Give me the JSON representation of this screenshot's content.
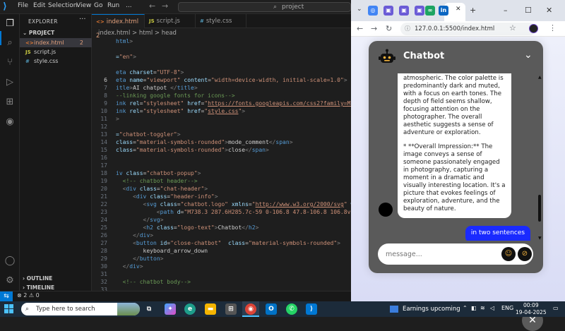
{
  "vscode": {
    "menu": [
      "File",
      "Edit",
      "Selection",
      "View",
      "Go",
      "Run",
      "..."
    ],
    "search_text": "project",
    "explorer": {
      "header": "EXPLORER",
      "project": "PROJECT",
      "files": [
        {
          "name": "index.html",
          "icon": "<>",
          "badge": "2"
        },
        {
          "name": "script.js",
          "icon": "JS",
          "badge": ""
        },
        {
          "name": "style.css",
          "icon": "#",
          "badge": ""
        }
      ],
      "outline": "OUTLINE",
      "timeline": "TIMELINE"
    },
    "tabs": [
      {
        "label": "index.html 2",
        "icon": "<>"
      },
      {
        "label": "script.js",
        "icon": "JS"
      },
      {
        "label": "style.css",
        "icon": "#"
      }
    ],
    "breadcrumb": "index.html  >  html  >  head",
    "line_numbers": [
      "",
      "",
      "",
      "",
      "",
      "6",
      "7",
      "8",
      "9",
      "10",
      "11",
      "12",
      "13",
      "14",
      "15",
      "16",
      "17",
      "18",
      "19",
      "20",
      "21",
      "22",
      "23",
      "24",
      "25",
      "26",
      "27",
      "28",
      "29",
      "30",
      "31",
      "32",
      "33"
    ],
    "status": {
      "problems": "⊗ 2 ⚠ 0"
    }
  },
  "browser": {
    "url": "127.0.0.1:5500/index.html",
    "window_controls": [
      "–",
      "☐",
      "✕"
    ]
  },
  "chatbot": {
    "title": "Chatbot",
    "bot_message_paragraphs": [
      "atmospheric. The color palette is predominantly dark and muted, with a focus on earth tones. The depth of field seems shallow, focusing attention on the photographer. The overall aesthetic suggests a sense of adventure or exploration.",
      "* **Overall Impression:** The image conveys a sense of someone passionately engaged in photography, capturing a moment in a dramatic and visually interesting location. It's a picture that evokes feelings of exploration, adventure, and the beauty of nature."
    ],
    "user_message": "in two sentences",
    "input_placeholder": "message..."
  },
  "taskbar": {
    "search_placeholder": "Type here to search",
    "news": "Earnings upcoming",
    "lang": "ENG",
    "time": "00:09",
    "date": "19-04-2025"
  },
  "colors": {
    "accent": "#0078d4",
    "chat_header": "#5a5a5a",
    "user_bubble": "#1a2aff"
  }
}
